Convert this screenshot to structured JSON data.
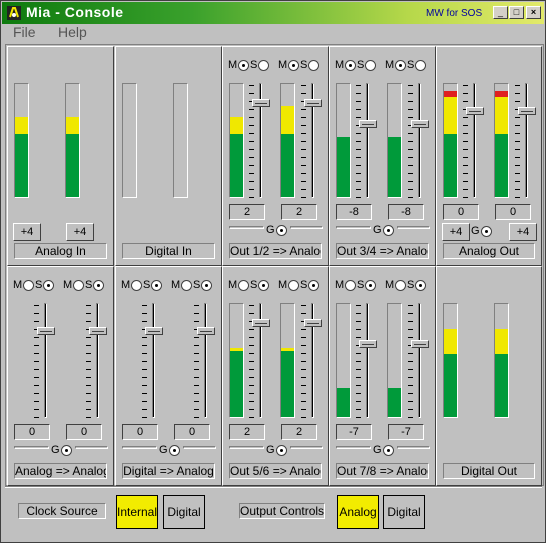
{
  "window": {
    "title": "Mia -  Console",
    "brand": "MW for SOS",
    "controls": [
      "_",
      "□",
      "×"
    ]
  },
  "menu": [
    {
      "label": "File"
    },
    {
      "label": "Help"
    }
  ],
  "colors": {
    "meter_green": "#009a3a",
    "meter_yellow": "#f0e800",
    "meter_red": "#e02020",
    "title_start": "#0e7a0e",
    "title_end": "#e3ea6a",
    "active_button": "#f2ec00"
  },
  "top_row": {
    "analog_in": {
      "label": "Analog In",
      "buttons": [
        "+4",
        "+4"
      ],
      "levels": [
        {
          "green": 0.56,
          "yellow": 0.15,
          "red": 0
        },
        {
          "green": 0.56,
          "yellow": 0.15,
          "red": 0
        }
      ]
    },
    "digital_in": {
      "label": "Digital In",
      "levels": [
        {
          "green": 0,
          "yellow": 0,
          "red": 0
        },
        {
          "green": 0,
          "yellow": 0,
          "red": 0
        }
      ]
    },
    "out12": {
      "label": "Out 1/2 => Analog",
      "values": [
        "2",
        "2"
      ],
      "m": "M",
      "s": "S",
      "g": "G",
      "levels": [
        {
          "green": 0.56,
          "yellow": 0.15,
          "red": 0
        },
        {
          "green": 0.56,
          "yellow": 0.25,
          "red": 0
        }
      ],
      "fader_pos": [
        0.15,
        0.15
      ]
    },
    "out34": {
      "label": "Out 3/4 => Analog",
      "values": [
        "-8",
        "-8"
      ],
      "m": "M",
      "s": "S",
      "g": "G",
      "levels": [
        {
          "green": 0.53,
          "yellow": 0,
          "red": 0
        },
        {
          "green": 0.53,
          "yellow": 0,
          "red": 0
        }
      ],
      "fader_pos": [
        0.35,
        0.35
      ]
    },
    "analog_out": {
      "label": "Analog Out",
      "values": [
        "0",
        "0"
      ],
      "buttons": [
        "+4",
        "+4"
      ],
      "g": "G",
      "levels": [
        {
          "green": 0.56,
          "yellow": 0.33,
          "red": 0.05
        },
        {
          "green": 0.56,
          "yellow": 0.33,
          "red": 0.05
        }
      ],
      "fader_pos": [
        0.22,
        0.22
      ]
    }
  },
  "bottom_row": {
    "analog_to_analog": {
      "label": "Analog => Analog",
      "values": [
        "0",
        "0"
      ],
      "m": "M",
      "s": "S",
      "g": "G",
      "fader_pos": [
        0.22,
        0.22
      ]
    },
    "digital_to_analog": {
      "label": "Digital => Analog",
      "values": [
        "0",
        "0"
      ],
      "m": "M",
      "s": "S",
      "g": "G",
      "fader_pos": [
        0.22,
        0.22
      ]
    },
    "out56": {
      "label": "Out 5/6 => Analog",
      "values": [
        "2",
        "2"
      ],
      "m": "M",
      "s": "S",
      "g": "G",
      "levels": [
        {
          "green": 0.58,
          "yellow": 0.03,
          "red": 0
        },
        {
          "green": 0.58,
          "yellow": 0.03,
          "red": 0
        }
      ],
      "fader_pos": [
        0.15,
        0.15
      ]
    },
    "out78": {
      "label": "Out 7/8 => Analog",
      "values": [
        "-7",
        "-7"
      ],
      "m": "M",
      "s": "S",
      "g": "G",
      "levels": [
        {
          "green": 0.26,
          "yellow": 0,
          "red": 0
        },
        {
          "green": 0.26,
          "yellow": 0,
          "red": 0
        }
      ],
      "fader_pos": [
        0.35,
        0.35
      ]
    },
    "digital_out": {
      "label": "Digital Out",
      "levels": [
        {
          "green": 0.56,
          "yellow": 0.22,
          "red": 0
        },
        {
          "green": 0.56,
          "yellow": 0.22,
          "red": 0
        }
      ]
    }
  },
  "footer": {
    "clock_source_label": "Clock Source",
    "clock_internal": "Internal",
    "clock_digital": "Digital",
    "output_controls_label": "Output Controls",
    "out_analog": "Analog",
    "out_digital": "Digital"
  }
}
